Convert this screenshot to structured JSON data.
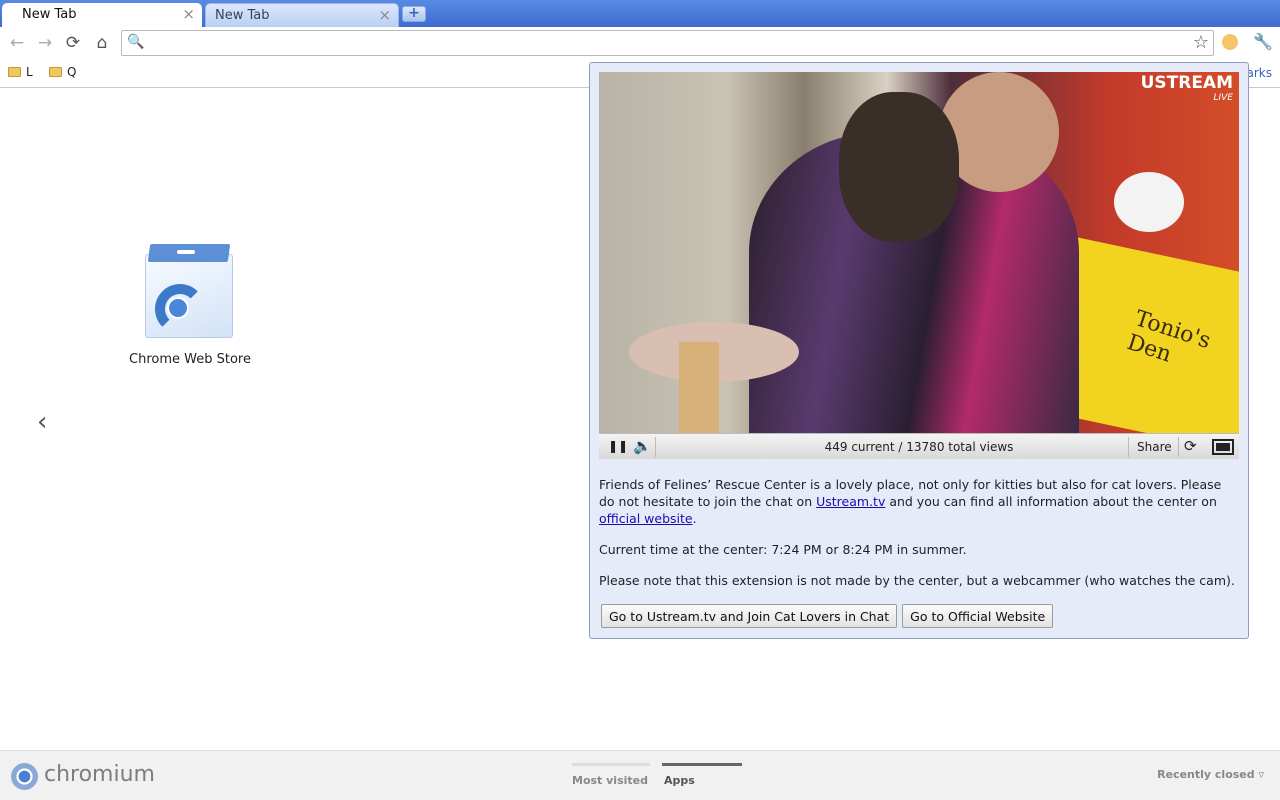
{
  "tabs": [
    {
      "label": "New Tab",
      "close": "×"
    },
    {
      "label": "New Tab",
      "close": "×"
    }
  ],
  "new_tab_button": "+",
  "toolbar": {
    "back": "←",
    "forward": "→",
    "reload": "⟳",
    "home": "⌂",
    "omnibox_value": "",
    "search_glyph": "🔍",
    "star_glyph": "☆",
    "wrench_glyph": "🔧"
  },
  "bookmarks": {
    "items": [
      {
        "label": "L"
      },
      {
        "label": "Q"
      }
    ],
    "other": "arks"
  },
  "apps": {
    "tiles": [
      {
        "label": "Chrome Web Store"
      }
    ],
    "prev_arrow": "‹"
  },
  "popup": {
    "logo": "USTREAM",
    "logo_sub": "LIVE",
    "video_text": "Tonio's Den",
    "controls": {
      "pause": "❚❚",
      "volume": "🔈",
      "views": "449 current / 13780 total views",
      "share": "Share",
      "refresh": "⟳"
    },
    "desc_part1": "Friends of Felines’ Rescue Center is a lovely place, not only for kitties but also for cat lovers. Please do not hesitate to join the chat on ",
    "desc_link1": "Ustream.tv",
    "desc_part2": " and you can find all information about the center on ",
    "desc_link2": "official website",
    "desc_part3": ".",
    "time_text": "Current time at the center: 7:24 PM or 8:24 PM in summer.",
    "note_text": "Please note that this extension is not made by the center, but a webcammer (who watches the cam).",
    "button_chat": "Go to Ustream.tv and Join Cat Lovers in Chat",
    "button_site": "Go to Official Website"
  },
  "bottom": {
    "logo_text": "chromium",
    "tab_most_visited": "Most visited",
    "tab_apps": "Apps",
    "recently_closed": "Recently closed ▿"
  }
}
